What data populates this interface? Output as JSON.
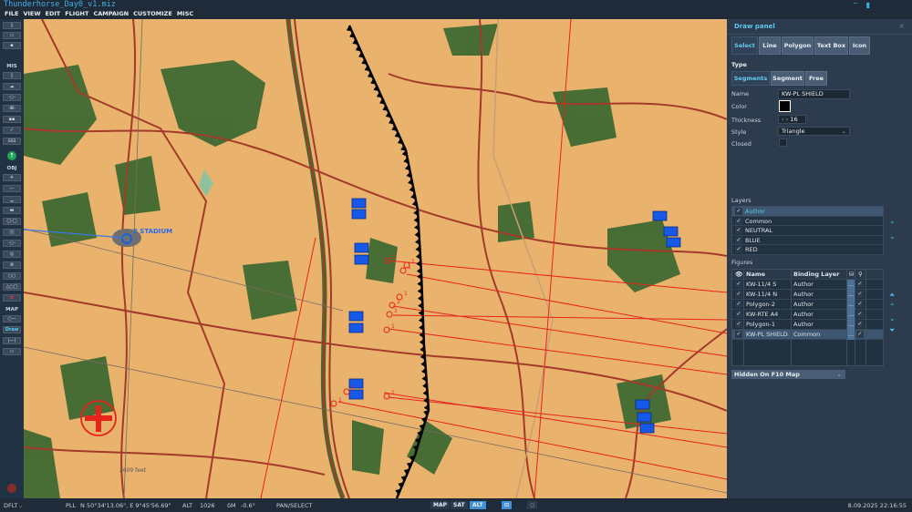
{
  "window": {
    "title": "Thunderhorse_Day0_v1.miz"
  },
  "menu": [
    "FILE",
    "VIEW",
    "EDIT",
    "FLIGHT",
    "CAMPAIGN",
    "CUSTOMIZE",
    "MISC"
  ],
  "toolbar": {
    "sections": {
      "mis": "MIS",
      "obj": "OBJ",
      "map": "MAP"
    },
    "draw_label": "Draw"
  },
  "map": {
    "labels": {
      "stadium": "3 STADIUM",
      "distance": "2609 feet"
    },
    "marker_labels": [
      "1",
      "1",
      "1",
      "1",
      "1",
      "1",
      "1",
      "1",
      "1",
      "1"
    ]
  },
  "panel": {
    "title": "Draw panel",
    "close": "×",
    "tools": [
      "Select",
      "Line",
      "Polygon",
      "Text Box",
      "Icon"
    ],
    "type_label": "Type",
    "types": [
      "Segments",
      "Segment",
      "Free"
    ],
    "name_label": "Name",
    "name_value": "KW-PL SHIELD",
    "color_label": "Color",
    "color_value": "#000000",
    "thickness_label": "Thickness",
    "thickness_value": "16",
    "style_label": "Style",
    "style_value": "Triangle",
    "closed_label": "Closed",
    "layers_label": "Layers",
    "layers": [
      "Author",
      "Common",
      "NEUTRAL",
      "BLUE",
      "RED"
    ],
    "figures_label": "Figures",
    "figures_headers": {
      "name": "Name",
      "layer": "Binding Layer"
    },
    "figures": [
      {
        "name": "KW-11/4 S",
        "layer": "Author"
      },
      {
        "name": "KW-11/4 N",
        "layer": "Author"
      },
      {
        "name": "Polygon-2",
        "layer": "Author"
      },
      {
        "name": "KW-RTE A4",
        "layer": "Author"
      },
      {
        "name": "Polygon-1",
        "layer": "Author"
      },
      {
        "name": "KW-PL SHIELD",
        "layer": "Common"
      }
    ],
    "dots": "...",
    "visibility_value": "Hidden On F10 Map"
  },
  "status": {
    "profile": "DFLT",
    "coord_label": "PLL",
    "coords": "N 50°34'13.06\", E 9°45'56.69\"",
    "alt_label": "ALT",
    "alt_value": "1026",
    "bm_label": "δM",
    "bm_value": "-0.6°",
    "mode": "PAN/SELECT",
    "map_modes": [
      "MAP",
      "SAT",
      "ALT"
    ],
    "datetime": "8.09.2025 22:16:55"
  }
}
